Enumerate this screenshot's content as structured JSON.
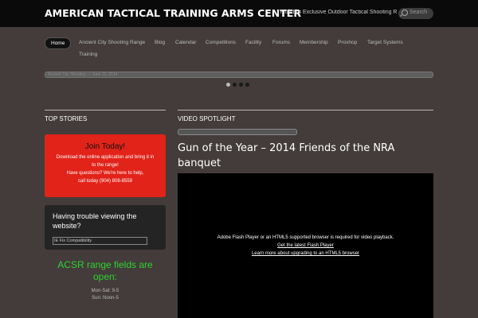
{
  "header": {
    "site_title": "AMERICAN TACTICAL TRAINING ARMS CENTER",
    "tagline": "| Florida's Exclusive Outdoor Tactical Shooting Range",
    "search_placeholder": "Search"
  },
  "nav": {
    "items": [
      {
        "label": "Home"
      },
      {
        "label": "Ancient City Shooting Range"
      },
      {
        "label": "Blog"
      },
      {
        "label": "Calendar"
      },
      {
        "label": "Competitions"
      },
      {
        "label": "Facility"
      },
      {
        "label": "Forums"
      },
      {
        "label": "Membership"
      },
      {
        "label": "Proshop"
      },
      {
        "label": "Target Systems"
      },
      {
        "label": "Training"
      }
    ]
  },
  "slider": {
    "caption": "Ancient City Shooting — June 21, 2014",
    "active_index": 0,
    "total": 4
  },
  "top_stories": {
    "heading": "TOP STORIES",
    "join": {
      "title": "Join Today!",
      "line1": "Download the online application and bring it in",
      "line2": "to the range!",
      "line3": "Have questions? We're here to help,",
      "line4": "call today (904) 808-8559"
    },
    "trouble": {
      "title": "Having trouble viewing the website?",
      "link": "IE Fix Compatibility"
    },
    "acsr": {
      "title": "ACSR range fields are open:",
      "hours1": "Mon-Sat: 9-5",
      "hours2": "Sun: Noon-5"
    }
  },
  "video": {
    "heading": "VIDEO SPOTLIGHT",
    "title": "Gun of the Year – 2014 Friends of the NRA banquet",
    "msg1": "Adobe Flash Player or an HTML5 supported browser is required for video playback.",
    "msg2": "Get the latest Flash Player",
    "msg3": "Learn more about upgrading to an HTML5 browser"
  },
  "colors": {
    "background": "#433c3b",
    "topbar": "#0a0a0a",
    "join_box": "#e2231a",
    "acsr_text": "#2fd32f"
  }
}
